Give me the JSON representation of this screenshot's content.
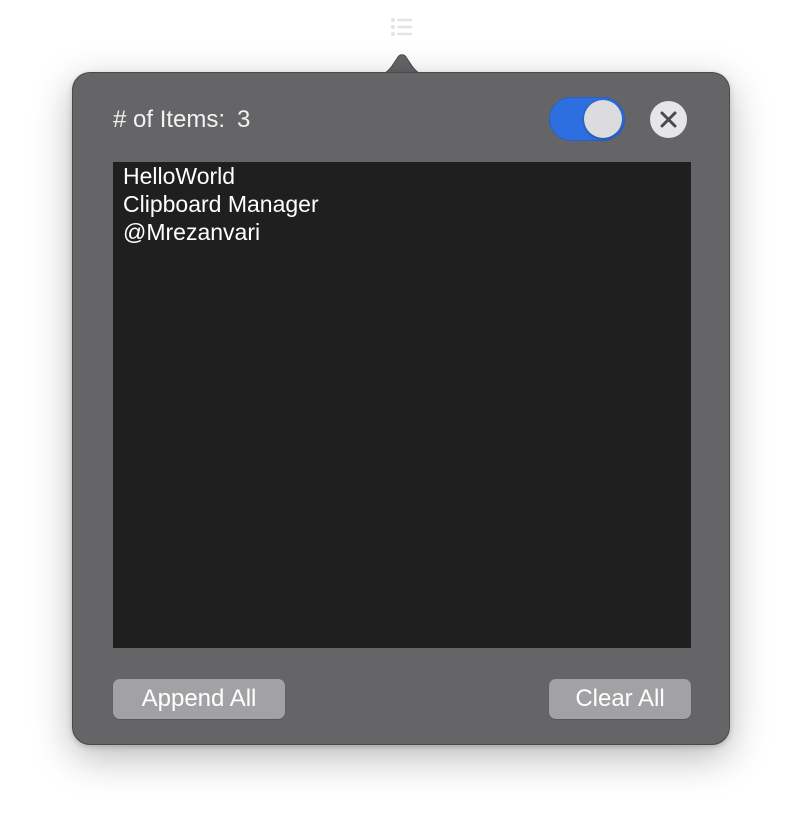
{
  "menubar": {
    "icon": "list-icon"
  },
  "header": {
    "count_label": "# of Items:",
    "count_value": "3",
    "toggle_on": true,
    "toggle_color": "#2d6fe0",
    "close_icon": "close-icon"
  },
  "clipboard": {
    "items": [
      "HelloWorld",
      "Clipboard Manager",
      "@Mrezanvari"
    ]
  },
  "footer": {
    "append_label": "Append All",
    "clear_label": "Clear All"
  }
}
